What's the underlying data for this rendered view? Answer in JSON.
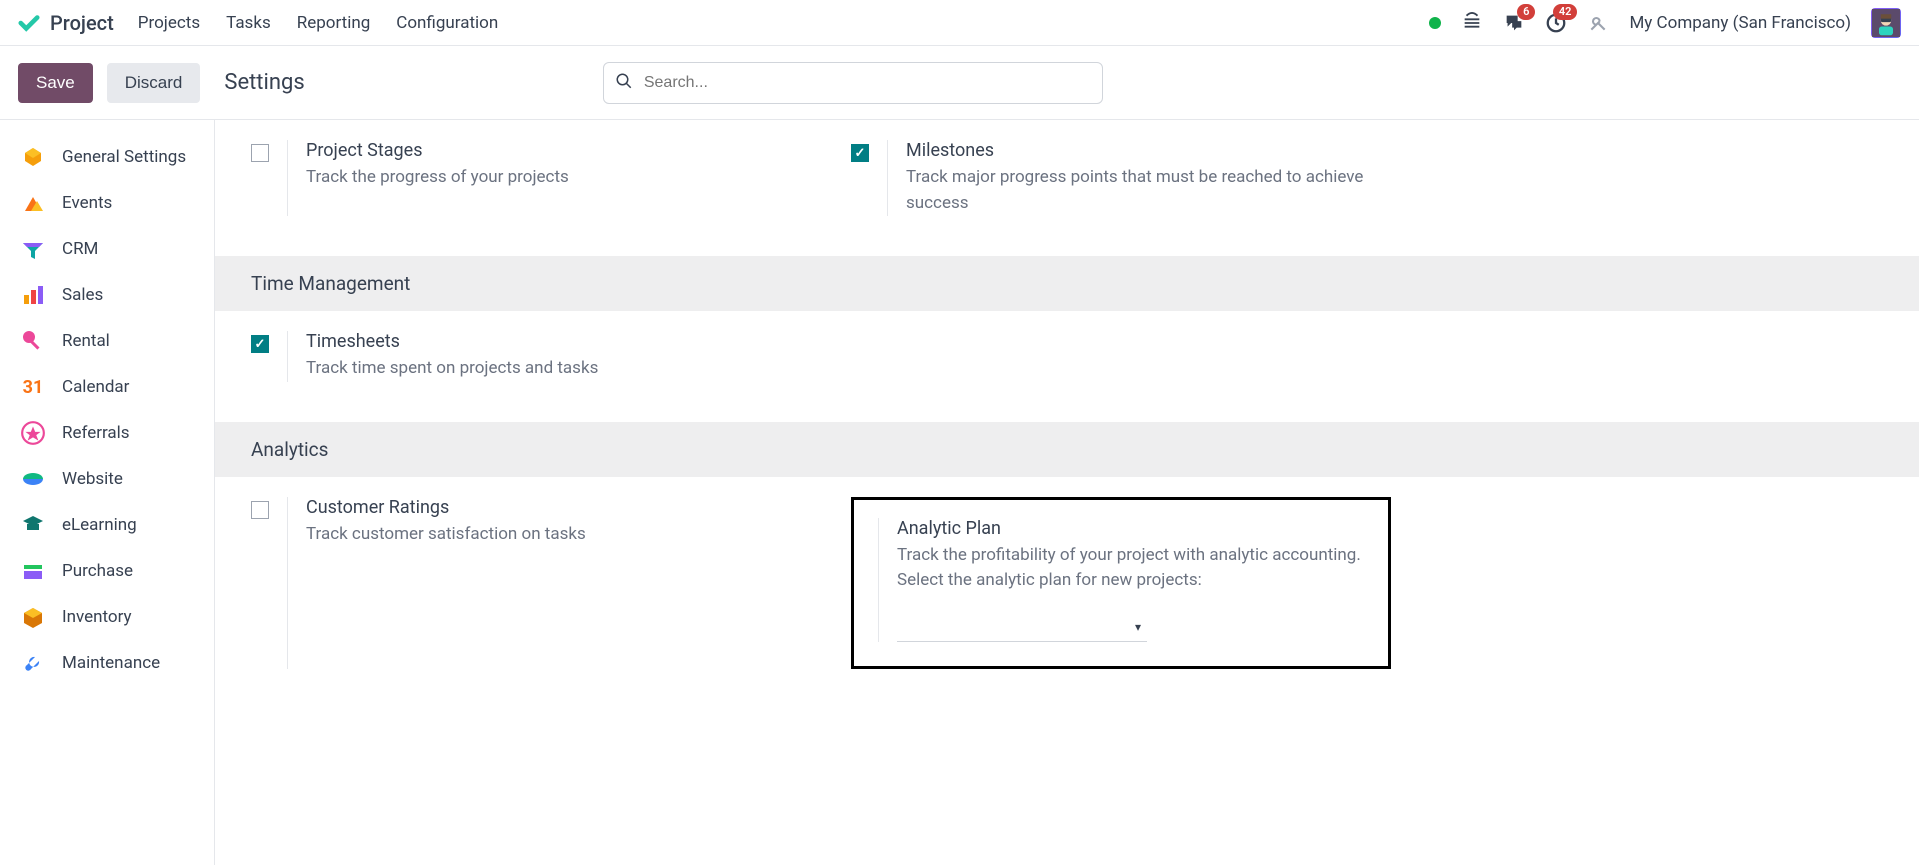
{
  "navbar": {
    "brand": "Project",
    "menu": [
      "Projects",
      "Tasks",
      "Reporting",
      "Configuration"
    ],
    "company": "My Company (San Francisco)",
    "badges": {
      "messages": "6",
      "activities": "42"
    }
  },
  "controlbar": {
    "save": "Save",
    "discard": "Discard",
    "title": "Settings",
    "search_placeholder": "Search..."
  },
  "sidebar": {
    "items": [
      {
        "label": "General Settings"
      },
      {
        "label": "Events"
      },
      {
        "label": "CRM"
      },
      {
        "label": "Sales"
      },
      {
        "label": "Rental"
      },
      {
        "label": "Calendar"
      },
      {
        "label": "Referrals"
      },
      {
        "label": "Website"
      },
      {
        "label": "eLearning"
      },
      {
        "label": "Purchase"
      },
      {
        "label": "Inventory"
      },
      {
        "label": "Maintenance"
      }
    ]
  },
  "settings": {
    "row1": {
      "project_stages": {
        "title": "Project Stages",
        "desc": "Track the progress of your projects"
      },
      "milestones": {
        "title": "Milestones",
        "desc": "Track major progress points that must be reached to achieve success"
      }
    },
    "section_time": "Time Management",
    "timesheets": {
      "title": "Timesheets",
      "desc": "Track time spent on projects and tasks"
    },
    "section_analytics": "Analytics",
    "customer_ratings": {
      "title": "Customer Ratings",
      "desc": "Track customer satisfaction on tasks"
    },
    "analytic_plan": {
      "title": "Analytic Plan",
      "desc": "Track the profitability of your project with analytic accounting. Select the analytic plan for new projects:"
    }
  }
}
